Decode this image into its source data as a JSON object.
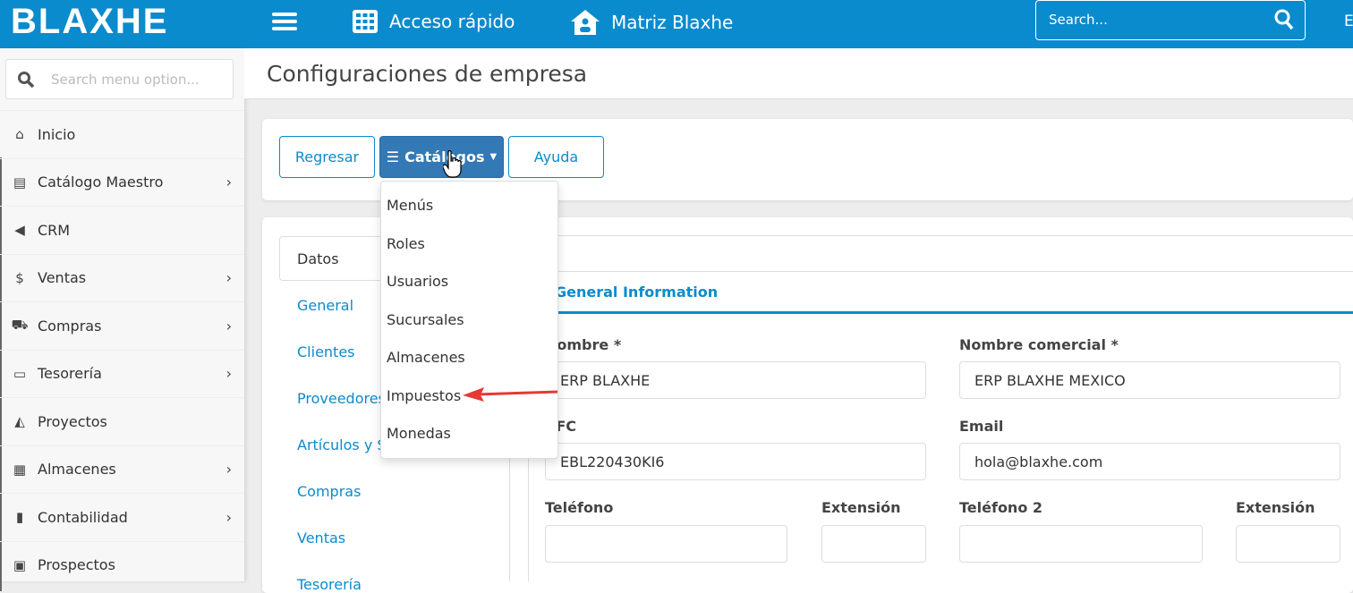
{
  "header": {
    "logo": "BLAXHE",
    "quick_access": "Acceso rápido",
    "branch": "Matriz Blaxhe",
    "search_placeholder": "Search...",
    "user_initial": "E",
    "brand_color": "#0a8bcd"
  },
  "sidebar": {
    "search_placeholder": "Search menu option...",
    "items": [
      {
        "label": "Inicio",
        "icon": "home-icon",
        "chevron": false
      },
      {
        "label": "Catálogo Maestro",
        "icon": "clipboard-icon",
        "chevron": true
      },
      {
        "label": "CRM",
        "icon": "bullhorn-icon",
        "chevron": false
      },
      {
        "label": "Ventas",
        "icon": "dollar-icon",
        "chevron": true
      },
      {
        "label": "Compras",
        "icon": "cart-icon",
        "chevron": true
      },
      {
        "label": "Tesorería",
        "icon": "money-icon",
        "chevron": true
      },
      {
        "label": "Proyectos",
        "icon": "area-chart-icon",
        "chevron": false
      },
      {
        "label": "Almacenes",
        "icon": "warehouse-icon",
        "chevron": true
      },
      {
        "label": "Contabilidad",
        "icon": "file-icon",
        "chevron": true
      },
      {
        "label": "Prospectos",
        "icon": "address-book-icon",
        "chevron": false
      }
    ]
  },
  "page": {
    "title": "Configuraciones de empresa"
  },
  "toolbar": {
    "back": "Regresar",
    "catalogs": "Catálogos",
    "help": "Ayuda"
  },
  "catalog_menu": [
    "Menús",
    "Roles",
    "Usuarios",
    "Sucursales",
    "Almacenes",
    "Impuestos",
    "Monedas"
  ],
  "left_tabs": {
    "active": "Datos",
    "items": [
      "General",
      "Clientes",
      "Proveedores",
      "Artículos y S",
      "Compras",
      "Ventas",
      "Tesorería"
    ]
  },
  "form": {
    "section": "General Information",
    "fields": {
      "nombre": {
        "label": "Nombre *",
        "value": "ERP BLAXHE"
      },
      "nombre_comercial": {
        "label": "Nombre comercial *",
        "value": "ERP BLAXHE MEXICO"
      },
      "rfc": {
        "label": "RFC",
        "value": "EBL220430KI6"
      },
      "email": {
        "label": "Email",
        "value": "hola@blaxhe.com"
      },
      "telefono": {
        "label": "Teléfono",
        "value": ""
      },
      "extension": {
        "label": "Extensión",
        "value": ""
      },
      "telefono2": {
        "label": "Teléfono 2",
        "value": ""
      },
      "extension2": {
        "label": "Extensión",
        "value": ""
      }
    }
  }
}
